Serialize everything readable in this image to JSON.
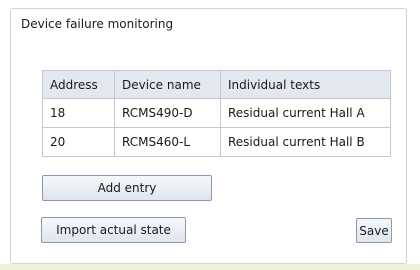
{
  "panel": {
    "title": "Device failure monitoring"
  },
  "table": {
    "columns": [
      "Address",
      "Device name",
      "Individual texts"
    ],
    "rows": [
      {
        "address": "18",
        "device_name": "RCMS490-D",
        "text": "Residual current Hall A"
      },
      {
        "address": "20",
        "device_name": "RCMS460-L",
        "text": "Residual current Hall B"
      }
    ]
  },
  "buttons": {
    "add_entry": "Add entry",
    "import_state": "Import actual state",
    "save": "Save"
  }
}
